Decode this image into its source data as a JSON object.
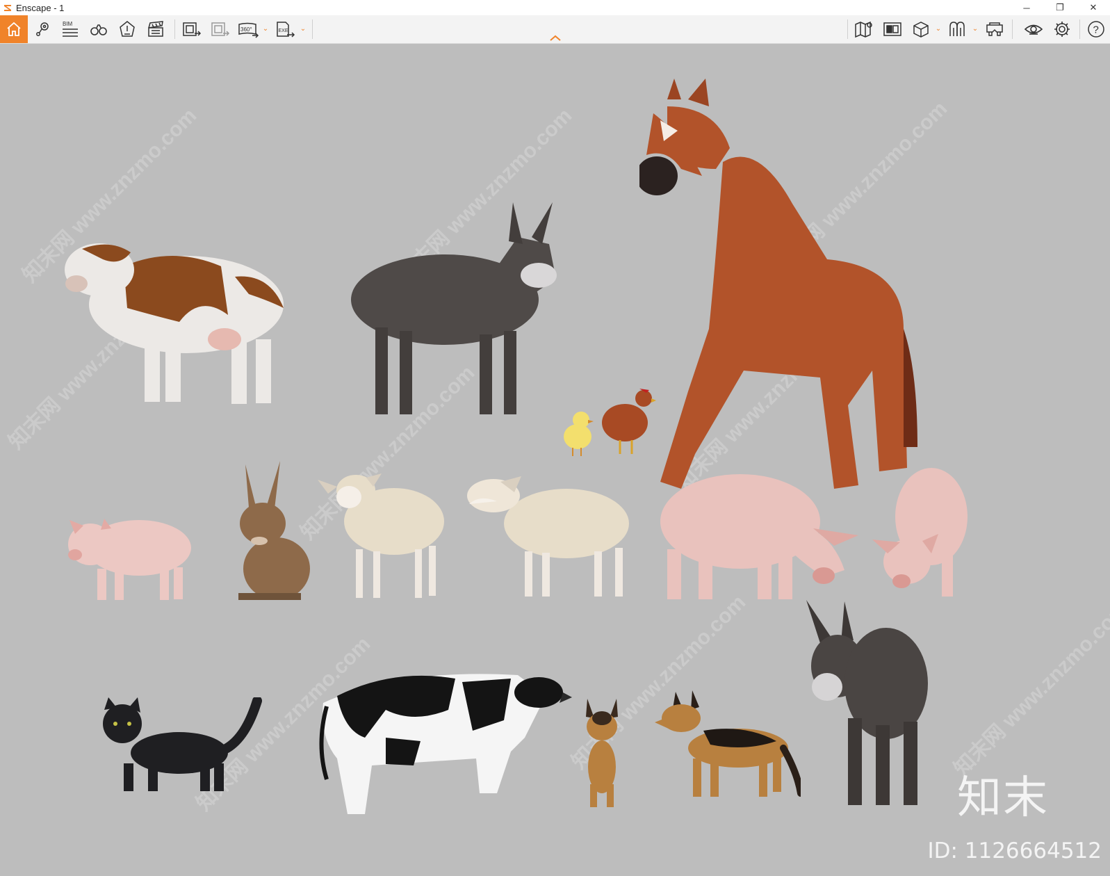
{
  "window": {
    "title": "Enscape - 1",
    "minimize_glyph": "─",
    "restore_glyph": "❐",
    "close_glyph": "✕"
  },
  "toolbar": {
    "bim_label": "BIM",
    "pano_label": "360°",
    "exe_label": "EXE",
    "help_label": "?",
    "accent_color": "#f0832a",
    "icons_left": [
      "home-icon",
      "location-pin-icon",
      "bim-icon",
      "binoculars-icon",
      "safe-frame-icon",
      "clapper-icon",
      "screenshot-export-icon",
      "batch-render-icon",
      "panorama-360-icon",
      "exe-export-icon"
    ],
    "icons_right": [
      "map-icon",
      "asset-library-icon",
      "cube-view-icon",
      "material-editor-icon",
      "vr-headset-icon",
      "eye-visual-settings-icon",
      "gear-settings-icon",
      "help-icon"
    ]
  },
  "viewport": {
    "background": "#bdbdbd",
    "watermark": "知末网 www.znzmo.com",
    "brand": "知末",
    "image_id": "ID: 1126664512",
    "animals": [
      "brown cow",
      "donkey",
      "chick",
      "hen",
      "horse",
      "piglet",
      "rabbit",
      "sheep",
      "sheep",
      "pig",
      "pig",
      "black cat",
      "holstein cow",
      "german shepherd puppy",
      "german shepherd",
      "donkey"
    ]
  }
}
